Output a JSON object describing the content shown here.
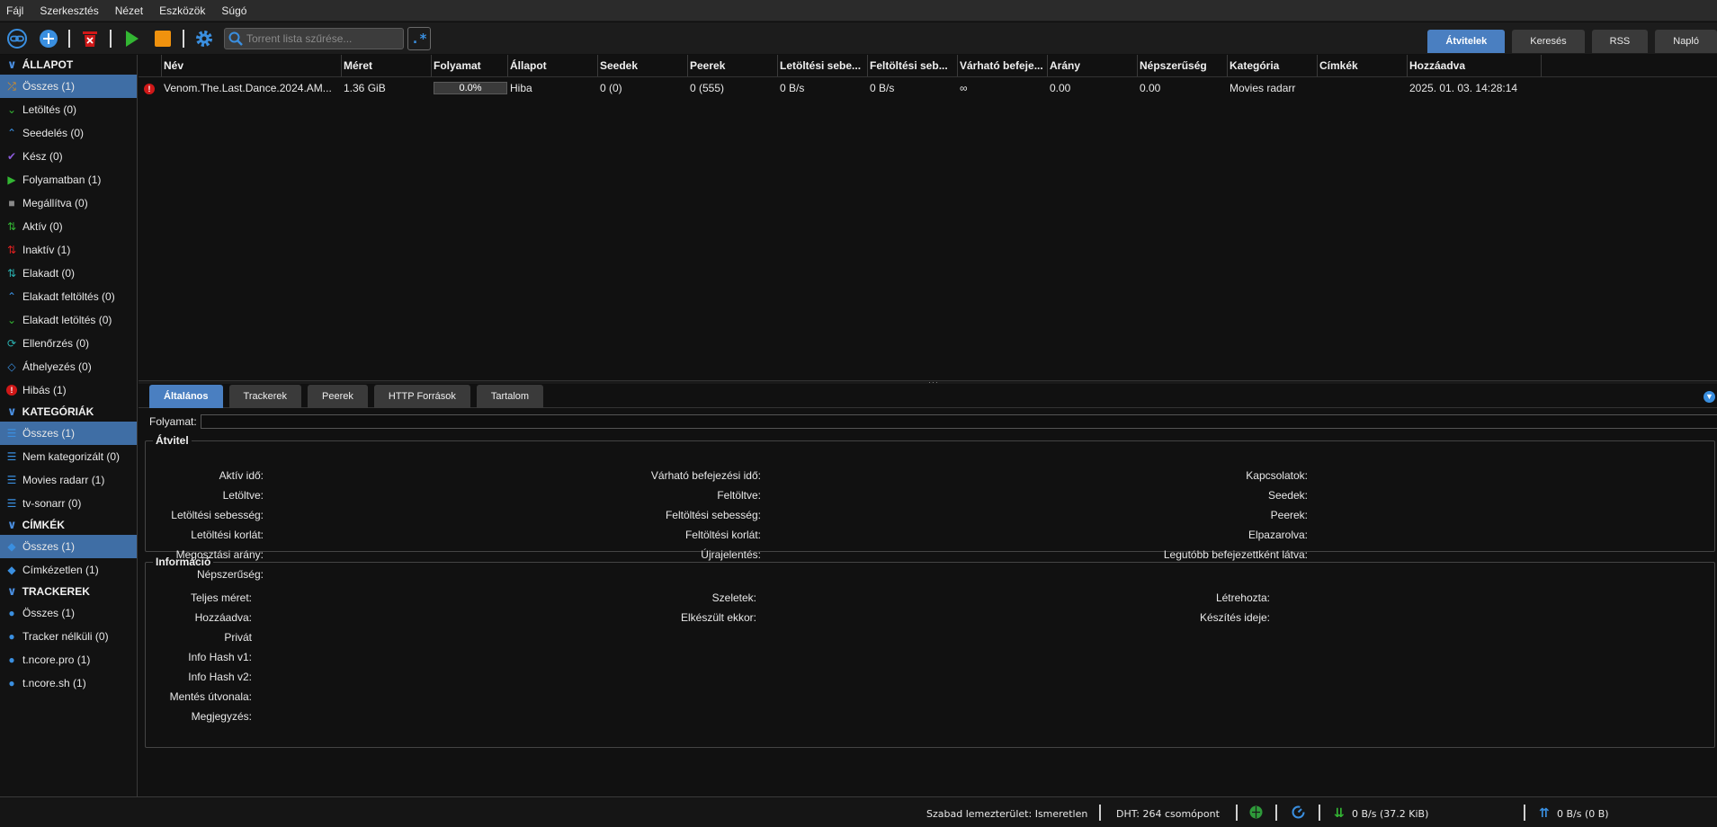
{
  "menu": [
    "Fájl",
    "Szerkesztés",
    "Nézet",
    "Eszközök",
    "Súgó"
  ],
  "search": {
    "placeholder": "Torrent lista szűrése..."
  },
  "regex_label": ".*",
  "top_tabs": [
    "Átvitelek",
    "Keresés",
    "RSS",
    "Napló"
  ],
  "sidebar": {
    "status_header": "ÁLLAPOT",
    "status": [
      "Összes (1)",
      "Letöltés (0)",
      "Seedelés (0)",
      "Kész (0)",
      "Folyamatban (1)",
      "Megállítva (0)",
      "Aktív (0)",
      "Inaktív (1)",
      "Elakadt (0)",
      "Elakadt feltöltés (0)",
      "Elakadt letöltés (0)",
      "Ellenőrzés (0)",
      "Áthelyezés (0)",
      "Hibás (1)"
    ],
    "categories_header": "KATEGÓRIÁK",
    "categories": [
      "Összes (1)",
      "Nem kategorizált (0)",
      "Movies radarr (1)",
      "tv-sonarr (0)"
    ],
    "tags_header": "CÍMKÉK",
    "tags": [
      "Összes (1)",
      "Címkézetlen (1)"
    ],
    "trackers_header": "TRACKEREK",
    "trackers": [
      "Összes (1)",
      "Tracker nélküli (0)",
      "t.ncore.pro (1)",
      "t.ncore.sh (1)"
    ]
  },
  "table": {
    "columns": [
      "Név",
      "Méret",
      "Folyamat",
      "Állapot",
      "Seedek",
      "Peerek",
      "Letöltési sebe...",
      "Feltöltési seb...",
      "Várható befeje...",
      "Arány",
      "Népszerűség",
      "Kategória",
      "Címkék",
      "Hozzáadva"
    ],
    "row": {
      "name": "Venom.The.Last.Dance.2024.AM...",
      "size": "1.36 GiB",
      "progress": "0.0%",
      "progress_fraction": 0,
      "state": "Hiba",
      "seeds": "0 (0)",
      "peers": "0 (555)",
      "dl_speed": "0 B/s",
      "ul_speed": "0 B/s",
      "eta": "∞",
      "ratio": "0.00",
      "popularity": "0.00",
      "category": "Movies radarr",
      "tags": "",
      "added": "2025. 01. 03. 14:28:14"
    }
  },
  "prop_tabs": [
    "Általános",
    "Trackerek",
    "Peerek",
    "HTTP Források",
    "Tartalom"
  ],
  "progress_label": "Folyamat:",
  "transfer": {
    "legend": "Átvitel",
    "col1": [
      "Aktív idő:",
      "Letöltve:",
      "Letöltési sebesség:",
      "Letöltési korlát:",
      "Megosztási arány:",
      "Népszerűség:"
    ],
    "col2": [
      "Várható befejezési idő:",
      "Feltöltve:",
      "Feltöltési sebesség:",
      "Feltöltési korlát:",
      "Újrajelentés:"
    ],
    "col3": [
      "Kapcsolatok:",
      "Seedek:",
      "Peerek:",
      "Elpazarolva:",
      "Legutóbb befejezettként látva:"
    ]
  },
  "info": {
    "legend": "Információ",
    "col1": [
      "Teljes méret:",
      "Hozzáadva:",
      "Privát",
      "Info Hash v1:",
      "Info Hash v2:",
      "Mentés útvonala:",
      "Megjegyzés:"
    ],
    "col2": [
      "Szeletek:",
      "Elkészült ekkor:"
    ],
    "col3": [
      "Létrehozta:",
      "Készítés ideje:"
    ]
  },
  "status": {
    "free_space": "Szabad lemezterület: Ismeretlen",
    "dht": "DHT: 264 csomópont",
    "dl": "0 B/s (37.2 KiB)",
    "ul": "0 B/s (0 B)"
  },
  "colors": {
    "accent": "#4a7fc1",
    "error": "#d01818"
  }
}
